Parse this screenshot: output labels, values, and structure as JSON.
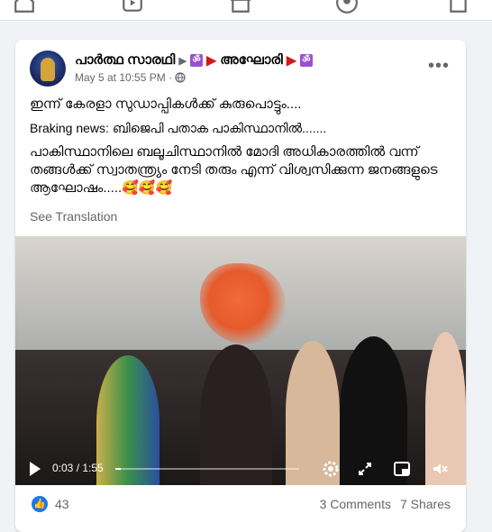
{
  "nav": {
    "icons": [
      "home-icon",
      "watch-icon",
      "marketplace-icon",
      "profile-icon",
      "pages-icon"
    ]
  },
  "post": {
    "author": "പാർത്ഥ സാരഥി",
    "author_suffix": "അഘോരി",
    "date": "May 5 at 10:55 PM",
    "line1": "ഇന്ന്  കേരളാ സുഡാപ്പികൾക്ക് കുരുപൊട്ടും....",
    "line2": "Braking news: ബിജെപി പതാക പാകിസ്ഥാനിൽ.......",
    "line3": "പാകിസ്ഥാനിലെ ബലൂചിസ്ഥാനിൽ മോദി അധികാരത്തിൽ വന്ന് തങ്ങൾക്ക് സ്വാതന്ത്ര്യം നേടി തരും എന്ന് വിശ്വസിക്കുന്ന ജനങ്ങളുടെ ആഘോഷം.....🥰🥰🥰",
    "see_translation": "See Translation",
    "om": "ॐ"
  },
  "video": {
    "time_current": "0:03",
    "time_sep": " / ",
    "time_total": "1:55",
    "progress": 0.027
  },
  "footer": {
    "like_count": "43",
    "comments": "3 Comments",
    "shares": "7 Shares"
  }
}
